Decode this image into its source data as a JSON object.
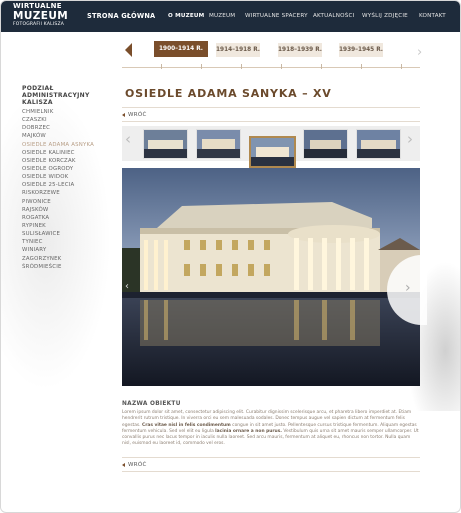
{
  "logo": {
    "line1": "WIRTUALNE",
    "line2": "MUZEUM",
    "line3": "FOTOGRAFII KALISZA"
  },
  "nav": {
    "home": "STRONA GŁÓWNA",
    "items": [
      "O MUZEUM",
      "MUZEUM",
      "WIRTUALNE SPACERY",
      "AKTUALNOŚCI",
      "WYŚLIJ ZDJĘCIE",
      "KONTAKT"
    ],
    "active_index": 0
  },
  "timeline": {
    "tabs": [
      "1900–1914 R.",
      "1914–1918 R.",
      "1918–1939 R.",
      "1939–1945 R."
    ],
    "active_index": 0
  },
  "sidebar": {
    "title_line1": "PODZIAŁ",
    "title_line2": "ADMINISTRACYJNY KALISZA",
    "items": [
      "CHMIELNIK",
      "CZASZKI",
      "DOBRZEC",
      "MAJKÓW",
      "OSIEDLE ADAMA ASNYKA",
      "OSIEDLE KALINIEC",
      "OSIEDLE KORCZAK",
      "OSIEDLE OGRODY",
      "OSIEDLE WIDOK",
      "OSIEDLE 25-LECIA",
      "RISKORZEWE",
      "PIWONICE",
      "RAJSKÓW",
      "ROGATKA",
      "RYPINEK",
      "SULISŁAWICE",
      "TYNIEC",
      "WINIARY",
      "ZAGORZYNEK",
      "ŚRÓDMIEŚCIE"
    ],
    "current_index": 4
  },
  "page": {
    "title": "OSIEDLE ADAMA SANYKA – XV",
    "back_label": "WRÓĆ",
    "object_label": "NAZWA OBIEKTU",
    "desc_1": "Lorem ipsum dolor sit amet, consectetur adipiscing elit. Curabitur dignissim scelerisque arcu, et pharetra libero imperdiet at. Etiam hendrerit rutrum tristique. In viverra orci eu sem malesuada sodales. Donec tempus augue vel sapien dictum at fermentum felis egestas.",
    "desc_bold": "Cras vitae nisl in felis condimentum",
    "desc_2": "congue in sit amet justo. Pellentesque cursus tristique fermentum. Aliquam egestas fermentum vehicula. Sed vel elit eu ligula",
    "desc_bold2": "lacinia ornare a non purus.",
    "desc_3": "Vestibulum quis urna sit amet mauris semper ullamcorper. Ut convallis purus nec lacus tempor in iaculis nulla laoreet. Sed arcu mauris, fermentum at aliquet eu, rhoncus non tortor. Nulla quam nisl, euismod eu laoreet id, commodo vel eros."
  },
  "colors": {
    "header_bg": "#1e2b3b",
    "accent_brown": "#7a4e2b",
    "tab_bg": "#f0e8de",
    "title_brown": "#6b4a2c"
  }
}
